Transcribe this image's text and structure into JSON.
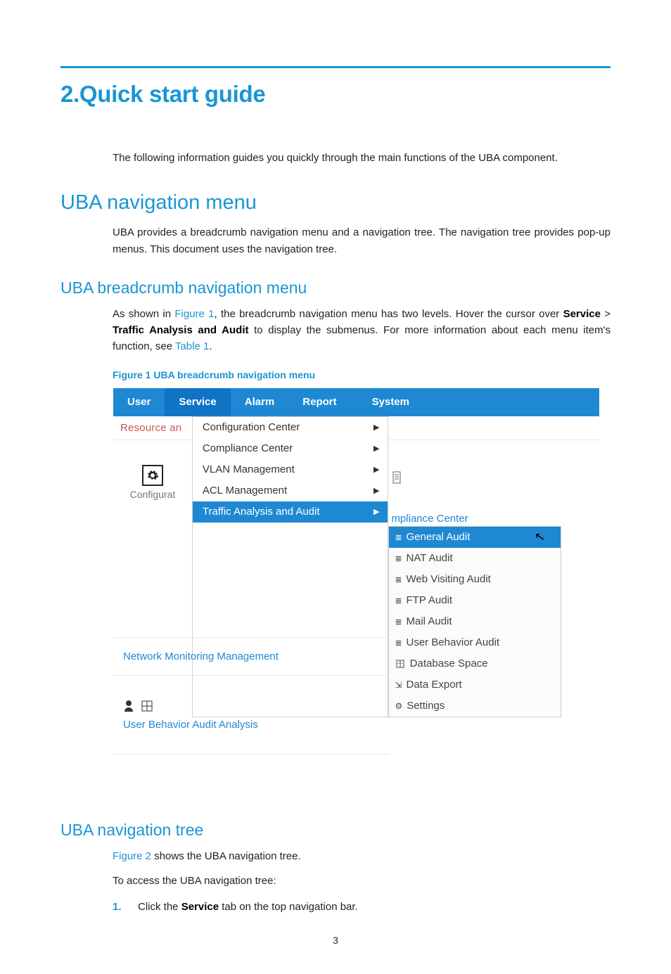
{
  "chapter": {
    "title": "2.Quick start guide"
  },
  "intro": "The following information guides you quickly through the main functions of the UBA component.",
  "section1": {
    "title": "UBA navigation menu",
    "para": "UBA provides a breadcrumb navigation menu and a navigation tree. The navigation tree provides pop-up menus. This document uses the navigation tree."
  },
  "sub1": {
    "title": "UBA breadcrumb navigation menu",
    "para_pre": "As shown in ",
    "fig_ref": "Figure 1",
    "para_mid1": ", the breadcrumb navigation menu has two levels. Hover the cursor over ",
    "bold1": "Service",
    "gt": " > ",
    "bold2": "Traffic Analysis and Audit",
    "para_mid2": " to display the submenus. For more information about each menu item's function, see ",
    "tbl_ref": "Table 1",
    "para_end": ".",
    "figcap": "Figure 1 UBA breadcrumb navigation menu"
  },
  "figure": {
    "menubar": {
      "user": "User",
      "service": "Service",
      "alarm": "Alarm",
      "report": "Report",
      "system": "System"
    },
    "left": {
      "resource": "Resource an",
      "configurat": "Configurat"
    },
    "dropdown": {
      "items": [
        "Configuration Center",
        "Compliance Center",
        "VLAN Management",
        "ACL Management",
        "Traffic Analysis and Audit"
      ]
    },
    "partial": "mpliance Center",
    "subpanel": [
      "General Audit",
      "NAT Audit",
      "Web Visiting Audit",
      "FTP Audit",
      "Mail Audit",
      "User Behavior Audit",
      "Database Space",
      "Data Export",
      "Settings"
    ],
    "cell_nmm": "Network Monitoring Management",
    "cell_ubaa": "User Behavior Audit Analysis"
  },
  "sub2": {
    "title": "UBA navigation tree",
    "p1_ref": "Figure 2",
    "p1_rest": " shows the UBA navigation tree.",
    "p2": "To access the UBA navigation tree:",
    "step_num": "1.",
    "step_pre": "Click the ",
    "step_bold": "Service",
    "step_post": " tab on the top navigation bar."
  },
  "pagenum": "3"
}
